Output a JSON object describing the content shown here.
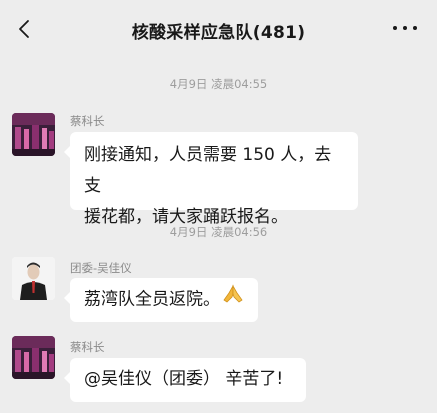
{
  "header": {
    "title": "核酸采样应急队(481)",
    "back_icon": "chevron-left-icon",
    "more_icon": "more-dots-icon"
  },
  "messages": [
    {
      "timestamp": "4月9日 凌晨04:55",
      "sender": "蔡科长",
      "text_lines": [
        "刚接通知，人员需要 150 人，去支",
        "援花都，请大家踊跃报名。"
      ]
    },
    {
      "timestamp": "4月9日 凌晨04:56",
      "sender": "团委-吴佳仪",
      "text": "荔湾队全员返院。",
      "emoji": "folded-hands-icon"
    },
    {
      "sender": "蔡科长",
      "text": "@吴佳仪（团委） 辛苦了!"
    }
  ]
}
